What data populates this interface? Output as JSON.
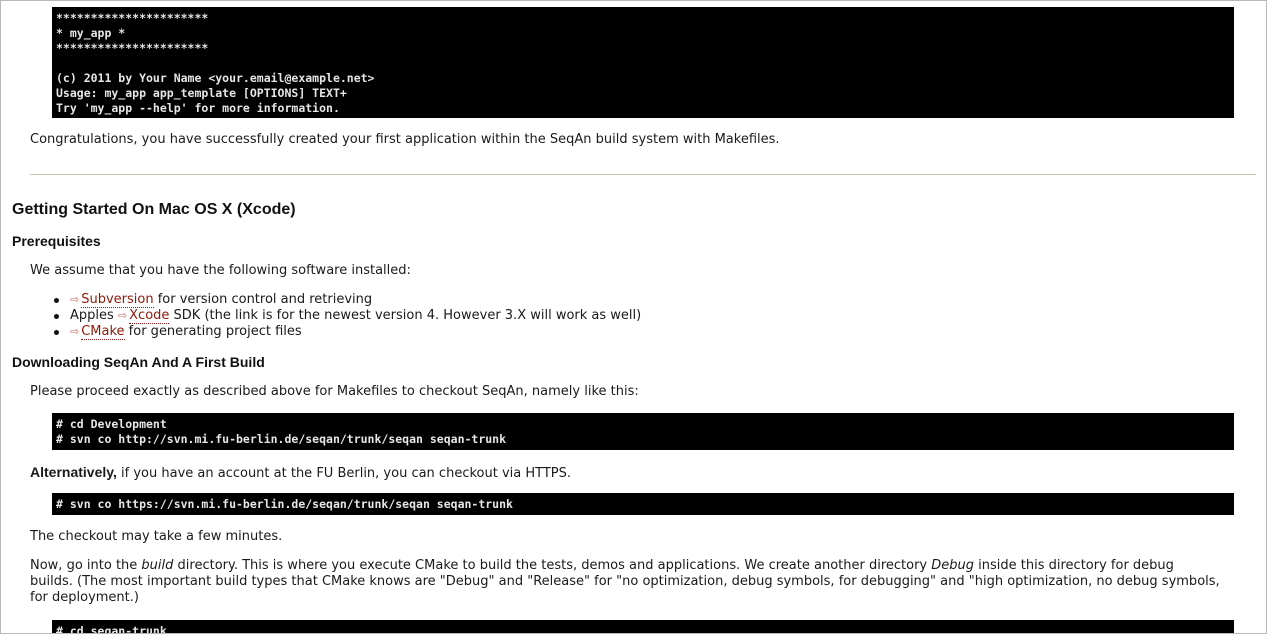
{
  "usage_block": {
    "lines": "**********************\n* my_app *\n**********************\n\n(c) 2011 by Your Name <your.email@example.net>\nUsage: my_app app_template [OPTIONS] TEXT+\nTry 'my_app --help' for more information."
  },
  "congrats_text": "Congratulations, you have successfully created your first application within the SeqAn build system with Makefiles.",
  "section_title": "Getting Started On Mac OS X (Xcode)",
  "prerequisites": {
    "heading": "Prerequisites",
    "intro": "We assume that you have the following software installed:",
    "items": [
      {
        "before": "",
        "link": "Subversion",
        "after": " for version control and retrieving"
      },
      {
        "before": "Apples ",
        "link": "Xcode",
        "after": " SDK (the link is for the newest version 4. However 3.X will work as well)"
      },
      {
        "before": "",
        "link": "CMake",
        "after": " for generating project files"
      }
    ],
    "link_icon": "external-link-icon"
  },
  "download": {
    "heading": "Downloading SeqAn And A First Build",
    "intro": "Please proceed exactly as described above for Makefiles to checkout SeqAn, namely like this:",
    "code1": "# cd Development\n# svn co http://svn.mi.fu-berlin.de/seqan/trunk/seqan seqan-trunk",
    "alt_label": "Alternatively,",
    "alt_text": " if you have an account at the FU Berlin, you can checkout via HTTPS.",
    "code2": "# svn co https://svn.mi.fu-berlin.de/seqan/trunk/seqan seqan-trunk",
    "checkout_note": "The checkout may take a few minutes.",
    "build_para": {
      "line1_a": "Now, go into the ",
      "line1_build": "build",
      "line1_b": " directory. This is where you execute CMake to build the tests, demos and applications. We create another directory ",
      "line1_debug": "Debug",
      "line1_c": " inside this directory for debug",
      "line2": "builds. (The most important build types that CMake knows are \"Debug\" and \"Release\" for \"no optimization, debug symbols, for debugging\" and \"high optimization, no debug symbols,",
      "line3": "for deployment.)"
    },
    "code3": "# cd seqan-trunk"
  }
}
